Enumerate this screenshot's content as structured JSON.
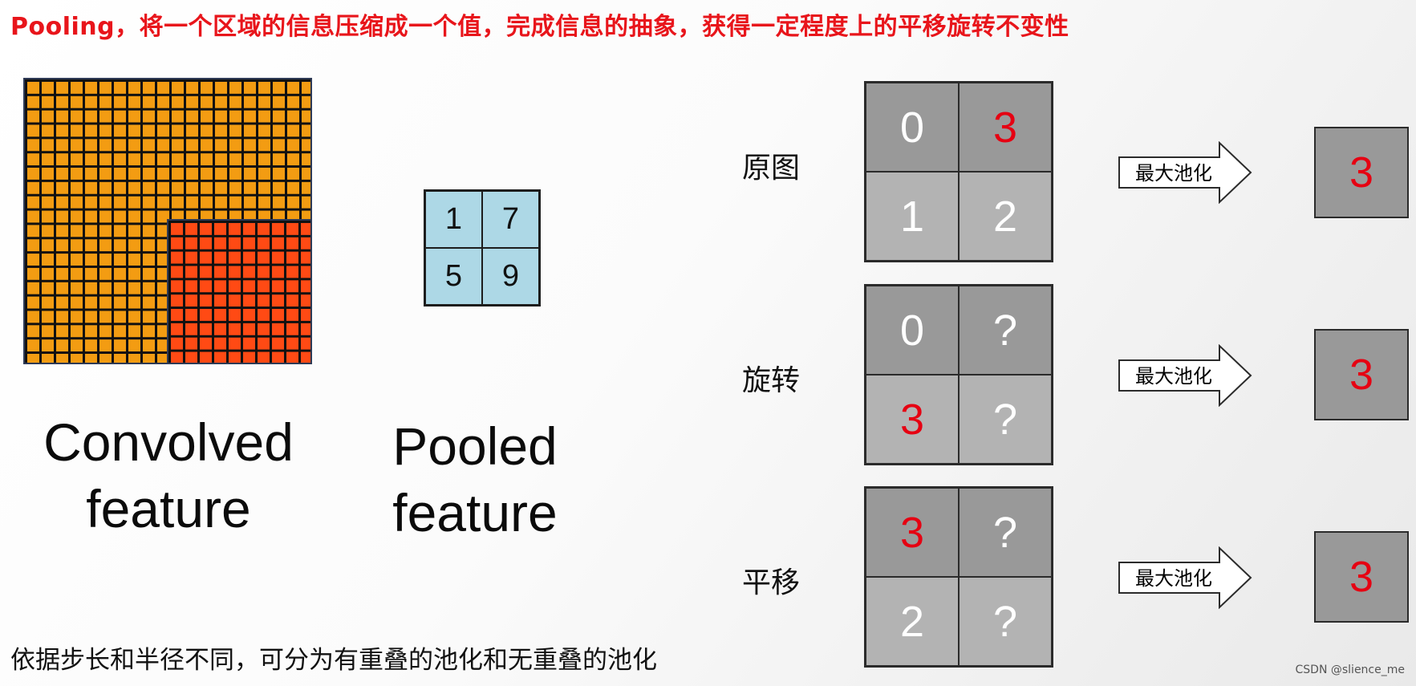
{
  "title": "Pooling，将一个区域的信息压缩成一个值，完成信息的抽象，获得一定程度上的平移旋转不变性",
  "left": {
    "convolved_caption_line1": "Convolved",
    "convolved_caption_line2": "feature",
    "pooled_caption_line1": "Pooled",
    "pooled_caption_line2": "feature",
    "pooled_values": [
      "1",
      "7",
      "5",
      "9"
    ],
    "colors": {
      "grid": "#f39c12",
      "highlight": "#ff4a14",
      "pooled": "#add8e6"
    }
  },
  "rows": [
    {
      "label": "原图",
      "cells": [
        "0",
        "3",
        "1",
        "2"
      ],
      "arrow_label": "最大池化",
      "result": "3"
    },
    {
      "label": "旋转",
      "cells": [
        "0",
        "?",
        "3",
        "?"
      ],
      "arrow_label": "最大池化",
      "result": "3"
    },
    {
      "label": "平移",
      "cells": [
        "3",
        "?",
        "2",
        "?"
      ],
      "arrow_label": "最大池化",
      "result": "3"
    }
  ],
  "footnote": "依据步长和半径不同，可分为有重叠的池化和无重叠的池化",
  "watermark": "CSDN @slience_me",
  "colors": {
    "title": "#e8151b",
    "highlight_number": "#e60012",
    "cell_dark": "#999999",
    "cell_light": "#b3b3b3"
  }
}
